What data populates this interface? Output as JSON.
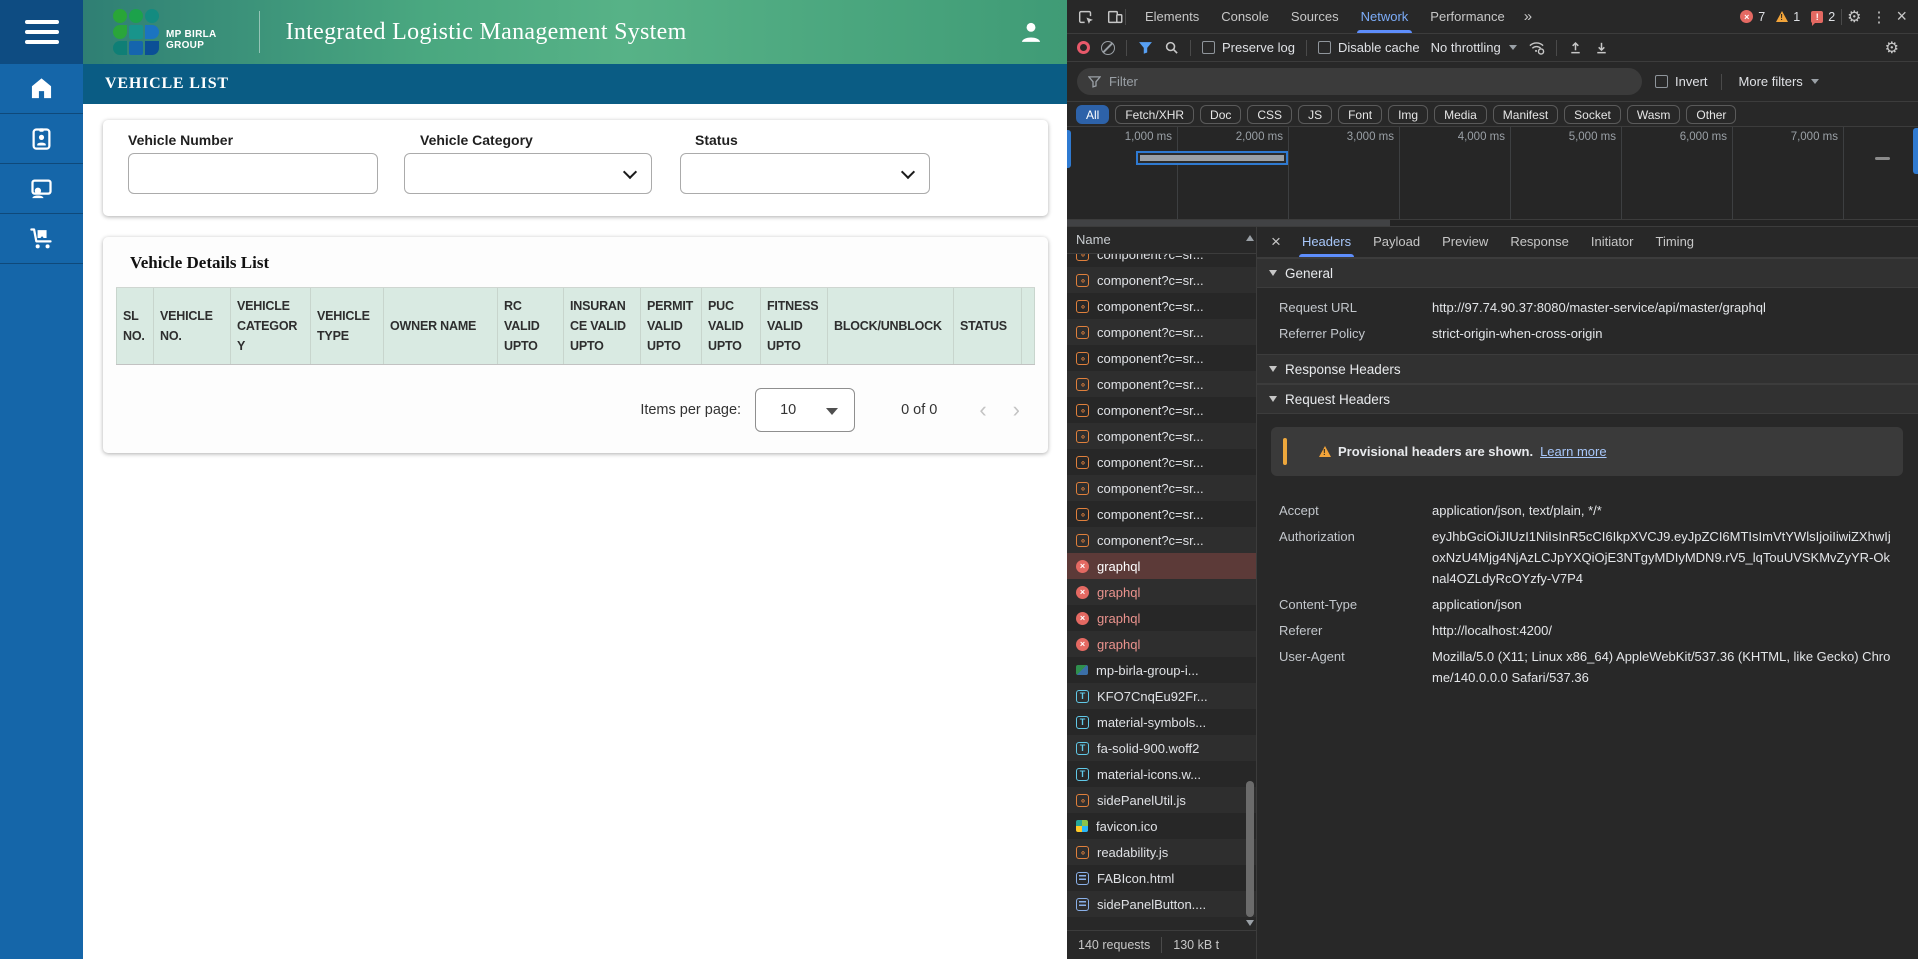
{
  "app": {
    "brand": {
      "line1": "MP BIRLA",
      "line2": "GROUP"
    },
    "title": "Integrated Logistic Management System",
    "page_title": "VEHICLE LIST",
    "filters": {
      "vehicle_number_label": "Vehicle Number",
      "vehicle_category_label": "Vehicle Category",
      "status_label": "Status"
    },
    "table": {
      "title": "Vehicle Details List",
      "columns": [
        "SL NO.",
        "VEHICLE NO.",
        "VEHICLE CATEGORY",
        "VEHICLE TYPE",
        "OWNER NAME",
        "RC VALID UPTO",
        "INSURANCE VALID UPTO",
        "PERMIT VALID UPTO",
        "PUC VALID UPTO",
        "FITNESS VALID UPTO",
        "BLOCK/UNBLOCK",
        "STATUS"
      ]
    },
    "pagination": {
      "items_per_page_label": "Items per page:",
      "page_size": "10",
      "range_label": "0 of 0",
      "prev_icon": "‹",
      "next_icon": "›"
    }
  },
  "devtools": {
    "main_tabs": [
      {
        "label": "Elements"
      },
      {
        "label": "Console"
      },
      {
        "label": "Sources"
      },
      {
        "label": "Network",
        "state": "active"
      },
      {
        "label": "Performance"
      }
    ],
    "icons": {
      "more_tabs": "»",
      "settings": "⚙",
      "menu": "⋮",
      "close": "×",
      "error_x": "×",
      "issue_mark": "!",
      "detail_close": "×"
    },
    "badges": {
      "errors": "7",
      "warnings": "1",
      "issues": "2"
    },
    "toolbar": {
      "preserve_log": "Preserve log",
      "disable_cache": "Disable cache",
      "throttling": "No throttling"
    },
    "filter": {
      "placeholder": "Filter",
      "invert": "Invert",
      "more_filters": "More filters"
    },
    "chips": [
      {
        "label": "All",
        "state": "active"
      },
      {
        "label": "Fetch/XHR"
      },
      {
        "label": "Doc"
      },
      {
        "label": "CSS"
      },
      {
        "label": "JS"
      },
      {
        "label": "Font"
      },
      {
        "label": "Img"
      },
      {
        "label": "Media"
      },
      {
        "label": "Manifest"
      },
      {
        "label": "Socket"
      },
      {
        "label": "Wasm"
      },
      {
        "label": "Other"
      }
    ],
    "timeline": {
      "ticks": [
        "1,000 ms",
        "2,000 ms",
        "3,000 ms",
        "4,000 ms",
        "5,000 ms",
        "6,000 ms",
        "7,000 ms"
      ]
    },
    "requests": {
      "name_header": "Name",
      "rows": [
        {
          "name": "component?c=sr...",
          "icon": "script",
          "state": "clipped"
        },
        {
          "name": "component?c=sr...",
          "icon": "script"
        },
        {
          "name": "component?c=sr...",
          "icon": "script"
        },
        {
          "name": "component?c=sr...",
          "icon": "script"
        },
        {
          "name": "component?c=sr...",
          "icon": "script"
        },
        {
          "name": "component?c=sr...",
          "icon": "script"
        },
        {
          "name": "component?c=sr...",
          "icon": "script"
        },
        {
          "name": "component?c=sr...",
          "icon": "script"
        },
        {
          "name": "component?c=sr...",
          "icon": "script"
        },
        {
          "name": "component?c=sr...",
          "icon": "script"
        },
        {
          "name": "component?c=sr...",
          "icon": "script"
        },
        {
          "name": "component?c=sr...",
          "icon": "script"
        },
        {
          "name": "graphql",
          "icon": "error",
          "state": "selected"
        },
        {
          "name": "graphql",
          "icon": "error",
          "state": "error"
        },
        {
          "name": "graphql",
          "icon": "error",
          "state": "error"
        },
        {
          "name": "graphql",
          "icon": "error",
          "state": "error"
        },
        {
          "name": "mp-birla-group-i...",
          "icon": "image-green"
        },
        {
          "name": "KFO7CnqEu92Fr...",
          "icon": "font"
        },
        {
          "name": "material-symbols...",
          "icon": "font"
        },
        {
          "name": "fa-solid-900.woff2",
          "icon": "font"
        },
        {
          "name": "material-icons.w...",
          "icon": "font"
        },
        {
          "name": "sidePanelUtil.js",
          "icon": "script"
        },
        {
          "name": "favicon.ico",
          "icon": "image-multi"
        },
        {
          "name": "readability.js",
          "icon": "script"
        },
        {
          "name": "FABIcon.html",
          "icon": "doc"
        },
        {
          "name": "sidePanelButton....",
          "icon": "doc"
        }
      ]
    },
    "summary": {
      "requests": "140 requests",
      "transferred": "130 kB t"
    },
    "details": {
      "tabs": [
        {
          "label": "Headers",
          "state": "active"
        },
        {
          "label": "Payload"
        },
        {
          "label": "Preview"
        },
        {
          "label": "Response"
        },
        {
          "label": "Initiator"
        },
        {
          "label": "Timing"
        }
      ],
      "sections": {
        "general": "General",
        "response_headers": "Response Headers",
        "request_headers": "Request Headers"
      },
      "general": [
        {
          "key": "Request URL",
          "value": "http://97.74.90.37:8080/master-service/api/master/graphql"
        },
        {
          "key": "Referrer Policy",
          "value": "strict-origin-when-cross-origin"
        }
      ],
      "warning": {
        "text": "Provisional headers are shown.",
        "link": "Learn more"
      },
      "request_headers": [
        {
          "key": "Accept",
          "value": "application/json, text/plain, */*"
        },
        {
          "key": "Authorization",
          "value": "eyJhbGciOiJIUzI1NiIsInR5cCI6IkpXVCJ9.eyJpZCI6MTIsImVtYWlsIjoiIiwiZXhwIjoxNzU4Mjg4NjAzLCJpYXQiOjE3NTgyMDIyMDN9.rV5_lqTouUVSKMvZyYR-Oknal4OZLdyRcOYzfy-V7P4"
        },
        {
          "key": "Content-Type",
          "value": "application/json"
        },
        {
          "key": "Referer",
          "value": "http://localhost:4200/"
        },
        {
          "key": "User-Agent",
          "value": "Mozilla/5.0 (X11; Linux x86_64) AppleWebKit/537.36 (KHTML, like Gecko) Chrome/140.0.0.0 Safari/537.36"
        }
      ]
    }
  },
  "colors": {
    "sidebar_blue": "#1566a9",
    "sidebar_top_blue": "#0e4c82",
    "header_gradient_start": "#2f7f74",
    "header_gradient_end": "#3f9b76",
    "page_bar_blue": "#0a5c84",
    "table_header_green": "#d9eae2",
    "devtools_bg": "#282828",
    "devtools_accent_blue": "#5e8efc",
    "error_red": "#e46962",
    "warning_orange": "#f2a43a",
    "selected_row_red": "#5c3a38",
    "script_icon_orange": "#e0803c",
    "font_icon_teal": "#61c9e8"
  }
}
